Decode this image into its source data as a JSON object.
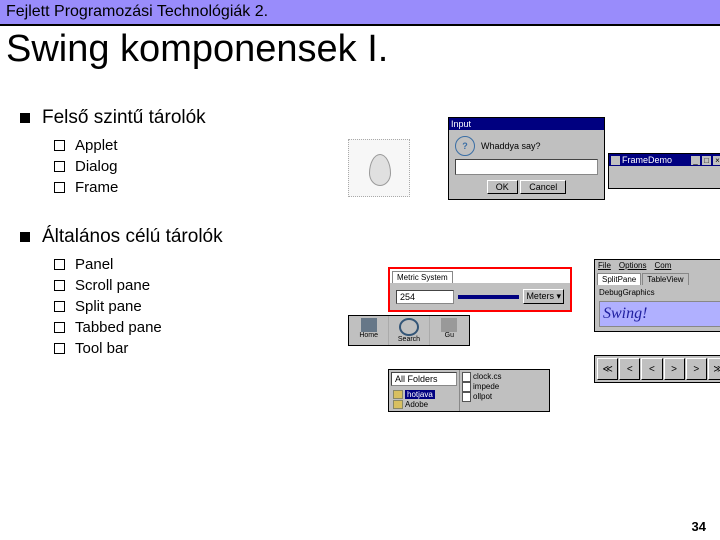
{
  "header": {
    "course": "Fejlett Programozási Technológiák 2."
  },
  "title": "Swing komponensek I.",
  "sections": [
    {
      "heading": "Felső szintű tárolók",
      "items": [
        "Applet",
        "Dialog",
        "Frame"
      ]
    },
    {
      "heading": "Általános célú tárolók",
      "items": [
        "Panel",
        "Scroll pane",
        "Split pane",
        "Tabbed pane",
        "Tool bar"
      ]
    }
  ],
  "dialog": {
    "title": "Input",
    "message": "Whaddya say?",
    "ok": "OK",
    "cancel": "Cancel"
  },
  "frame": {
    "title": "FrameDemo",
    "controls": {
      "min": "_",
      "max": "□",
      "close": "×"
    }
  },
  "panel": {
    "tab": "Metric System",
    "value": "254",
    "unit": "Meters",
    "dropdown": "▾"
  },
  "splitpane": {
    "menus": [
      "File",
      "Options",
      "Com"
    ],
    "tabs": [
      "SplitPane",
      "TableView"
    ],
    "label": "DebugGraphics",
    "big": "Swing!"
  },
  "tabbed": {
    "combo": "All Folders",
    "tree": [
      "hotjava",
      "Adobe"
    ],
    "list": [
      "clock.cs",
      "impede",
      "ollpot"
    ]
  },
  "toolbar": {
    "icons": [
      "Home",
      "Search",
      "Gu"
    ],
    "btns": [
      "≪",
      "<",
      "<",
      ">",
      ">",
      "≫"
    ]
  },
  "page": "34"
}
